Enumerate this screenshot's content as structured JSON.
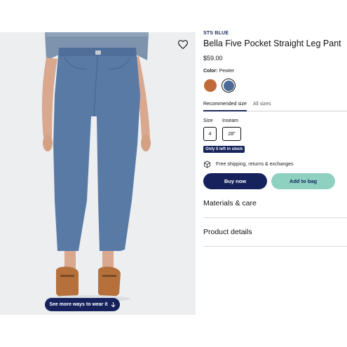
{
  "product": {
    "brand": "STS BLUE",
    "title": "Bella Five Pocket Straight Leg Pant",
    "price": "$59.00"
  },
  "color": {
    "label": "Color:",
    "value": "Pewter",
    "swatches": [
      {
        "name": "rust",
        "hex": "#c06a3a"
      },
      {
        "name": "pewter",
        "hex": "#4d6a96",
        "selected": true
      }
    ]
  },
  "size_tabs": {
    "recommended": "Recommended size",
    "all": "All sizes"
  },
  "size": {
    "size_label": "Size",
    "inseam_label": "Inseam",
    "size_value": "4",
    "inseam_value": "28\""
  },
  "stock_badge": "Only 5 left in stock",
  "shipping": {
    "icon": "box-icon",
    "text": "Free shipping, returns & exchanges"
  },
  "buttons": {
    "buy_now": "Buy now",
    "add_to_bag": "Add to bag"
  },
  "sections": {
    "materials": "Materials & care",
    "details": "Product details"
  },
  "image": {
    "see_more": "See more ways to wear it",
    "wishlist_icon": "heart-icon"
  },
  "colors": {
    "navy": "#15225c",
    "mint": "#8fd1c1",
    "denim": "#4d6a96"
  }
}
